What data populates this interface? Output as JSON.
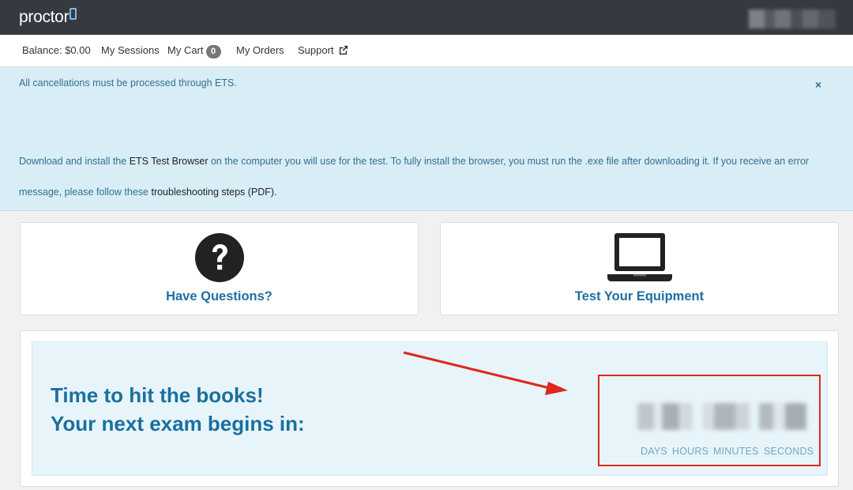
{
  "header": {
    "logo_text": "proctor"
  },
  "subnav": {
    "balance": "Balance: $0.00",
    "sessions": "My Sessions",
    "cart": "My Cart",
    "cart_count": "0",
    "orders": "My Orders",
    "support": "Support"
  },
  "alert": {
    "line1": "All cancellations must be processed through ETS.",
    "para_part1": "Download and install the ",
    "para_link1": "ETS Test Browser",
    "para_part2": " on the computer you will use for the test. To fully install the browser, you must run the .exe file after downloading it. If you receive an error message, please follow these ",
    "para_link2": "troubleshooting steps (PDF).",
    "close": "×"
  },
  "cards": {
    "questions_label": "Have Questions?",
    "equipment_label": "Test Your Equipment"
  },
  "countdown": {
    "line1": "Time to hit the books!",
    "line2": "Your next exam begins in:",
    "labels": {
      "days": "DAYS",
      "hours": "HOURS",
      "minutes": "MINUTES",
      "seconds": "SECONDS"
    }
  },
  "colors": {
    "accent": "#1f6fa3",
    "annotation": "#e0261d",
    "alert_bg": "#d9edf7"
  }
}
